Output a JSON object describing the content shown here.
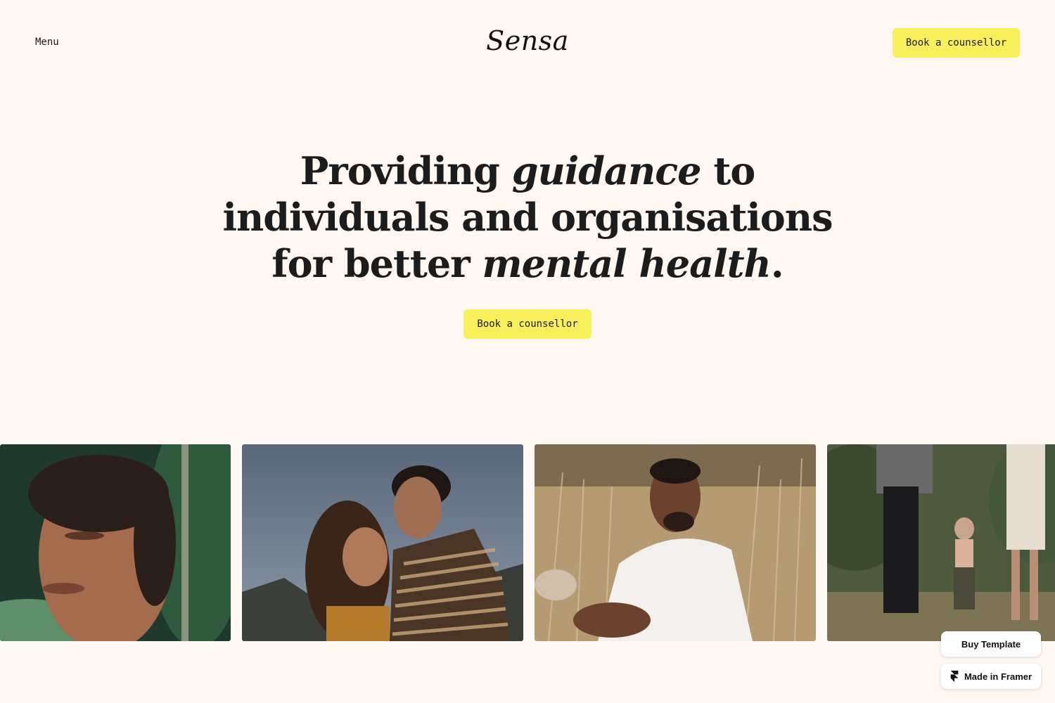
{
  "header": {
    "menu_label": "Menu",
    "logo": "Sensa",
    "cta_label": "Book a counsellor"
  },
  "hero": {
    "line1_a": "Providing ",
    "line1_em": "guidance",
    "line1_b": " to",
    "line2": "individuals and organisations",
    "line3_a": "for better ",
    "line3_em": "mental health",
    "line3_b": ".",
    "cta_label": "Book a counsellor"
  },
  "gallery": [
    {
      "subject": "woman-eyes-closed-portrait"
    },
    {
      "subject": "couple-kissing-forehead"
    },
    {
      "subject": "man-laughing-in-field"
    },
    {
      "subject": "family-walking-with-toddler"
    }
  ],
  "badges": {
    "buy_label": "Buy Template",
    "framer_label": "Made in Framer"
  },
  "colors": {
    "background": "#fff7f1",
    "accent_yellow": "#f8f05b",
    "text": "#1a1a1a"
  }
}
